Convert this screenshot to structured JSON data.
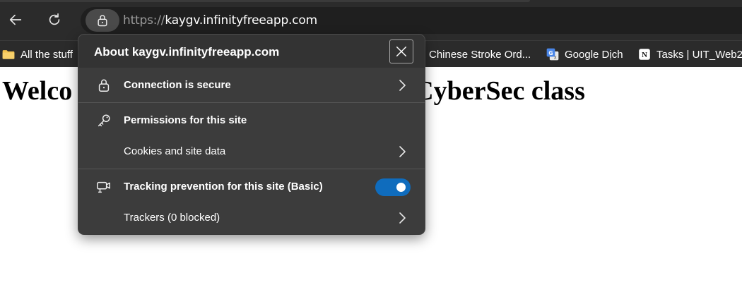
{
  "browser": {
    "url_scheme": "https://",
    "url_host": "kaygv.infinityfreeapp.com",
    "icons": {
      "back": "back-arrow-icon",
      "refresh": "refresh-icon",
      "site_info": "lock-icon"
    }
  },
  "bookmarks": [
    {
      "label": "All the stuff",
      "icon": "folder-icon"
    },
    {
      "label": "Chinese Stroke Ord...",
      "icon": "none"
    },
    {
      "label": "Google Dịch",
      "icon": "google-translate-icon"
    },
    {
      "label": "Tasks | UIT_Web2",
      "icon": "notion-icon"
    }
  ],
  "page": {
    "heading_left": "Welco",
    "heading_right": "CyberSec class"
  },
  "popup": {
    "title": "About kaygv.infinityfreeapp.com",
    "rows": [
      {
        "label": "Connection is secure",
        "icon": "lock-icon",
        "has_chevron": true
      },
      {
        "label": "Permissions for this site",
        "icon": "key-icon",
        "has_chevron": false
      },
      {
        "label": "Cookies and site data",
        "icon": "none",
        "has_chevron": true
      },
      {
        "label": "Tracking prevention for this site (Basic)",
        "icon": "tracking-camera-icon",
        "toggle_on": true
      },
      {
        "label": "Trackers (0 blocked)",
        "icon": "none",
        "has_chevron": true
      }
    ]
  },
  "colors": {
    "toolbar": "#2b2b2b",
    "popup_bg": "#3c3c3c",
    "toggle_on": "#0f6cbd"
  }
}
